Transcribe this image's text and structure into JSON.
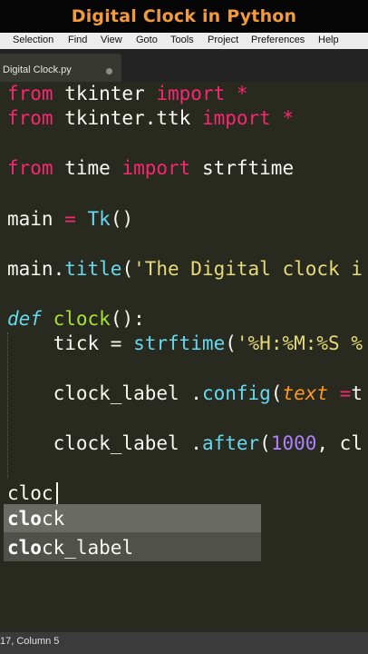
{
  "banner": {
    "title": "Digital Clock in Python"
  },
  "menubar": {
    "items": [
      "Selection",
      "Find",
      "View",
      "Goto",
      "Tools",
      "Project",
      "Preferences",
      "Help"
    ]
  },
  "tab": {
    "label": "Digital Clock.py"
  },
  "code": {
    "l1": {
      "a": "from",
      "b": " tkinter ",
      "c": "import",
      "d": " *"
    },
    "l2": {
      "a": "from",
      "b": " tkinter.ttk ",
      "c": "import",
      "d": " *"
    },
    "l3": {
      "a": "from",
      "b": " time ",
      "c": "import",
      "d": " strftime"
    },
    "l4": {
      "a": "main",
      "b": " = ",
      "c": "Tk",
      "d": "()"
    },
    "l5": {
      "a": "main.",
      "b": "title",
      "c": "(",
      "d": "'The Digital clock i"
    },
    "l6": {
      "a": "def",
      "b": " ",
      "c": "clock",
      "d": "():"
    },
    "l7": {
      "a": "    tick = ",
      "b": "strftime",
      "c": "(",
      "d": "'%H:%M:%S %"
    },
    "l8": {
      "a": "    clock_label .",
      "b": "config",
      "c": "(",
      "d": "text",
      "e": " =",
      "f": "t"
    },
    "l9": {
      "a": "    clock_label .",
      "b": "after",
      "c": "(",
      "d": "1000",
      "e": ", cl"
    },
    "l10": {
      "a": "cloc"
    }
  },
  "autocomplete": {
    "items": [
      {
        "match": "clo",
        "rest": "ck"
      },
      {
        "match": "clo",
        "rest": "ck_label"
      }
    ]
  },
  "status": {
    "text": "17, Column 5"
  },
  "colors": {
    "banner_title": "#f39a3b",
    "editor_bg": "#28291f",
    "keyword": "#f92672",
    "function": "#66d9ef",
    "string": "#e6db74",
    "number": "#ae81ff",
    "parameter": "#fd971f",
    "def_name": "#a6e22e"
  }
}
